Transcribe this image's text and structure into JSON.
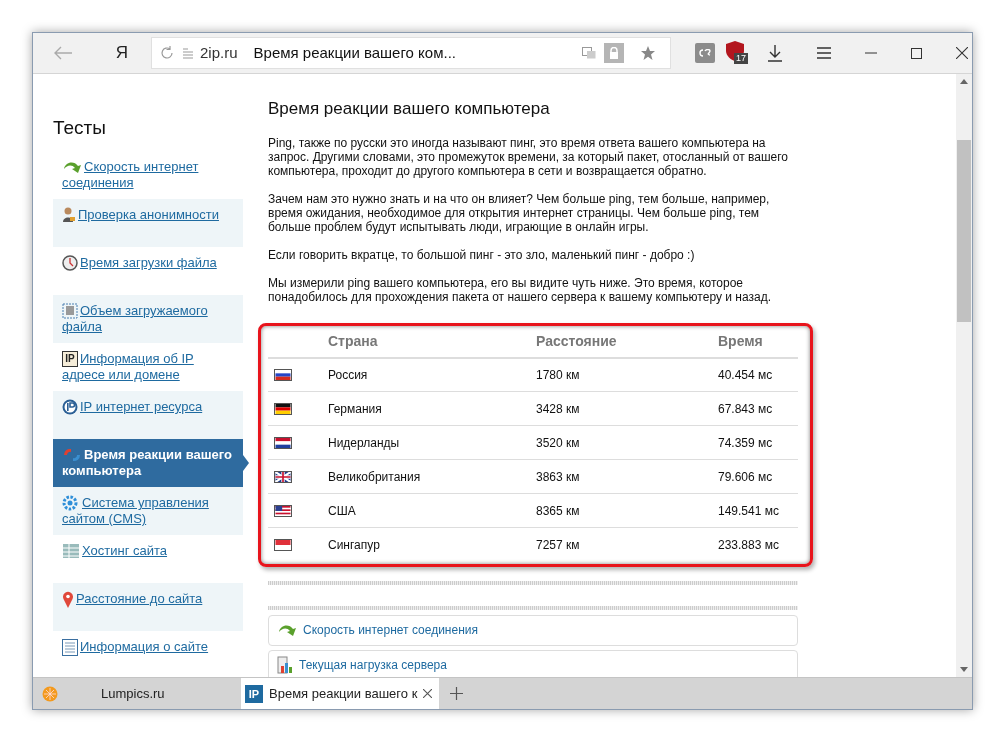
{
  "toolbar": {
    "logo": "Я",
    "domain": "2ip.ru",
    "page_title": "Время реакции вашего ком...",
    "extension_badge": "17"
  },
  "sidebar": {
    "title": "Тесты",
    "items": [
      {
        "label": "Скорость интернет соединения",
        "selected": false
      },
      {
        "label": "Проверка анонимности",
        "selected": false
      },
      {
        "label": "Время загрузки файла",
        "selected": false
      },
      {
        "label": "Объем загружаемого файла",
        "selected": false
      },
      {
        "label": "Информация об IP адресе или домене",
        "selected": false,
        "icon_label": "IP"
      },
      {
        "label": "IP интернет ресурса",
        "selected": false
      },
      {
        "label": "Время реакции вашего компьютера",
        "selected": true
      },
      {
        "label": "Система управления сайтом (CMS)",
        "selected": false
      },
      {
        "label": "Хостинг сайта",
        "selected": false
      },
      {
        "label": "Расстояние до сайта",
        "selected": false
      },
      {
        "label": "Информация о сайте",
        "selected": false
      }
    ]
  },
  "article": {
    "title": "Время реакции вашего компьютера",
    "paragraphs": [
      "Ping, также по русски это иногда называют пинг, это время ответа вашего компьютера на запрос. Другими словами, это промежуток времени, за который пакет, отосланный от вашего компьютера, проходит до другого компьютера в сети и возвращается обратно.",
      "Зачем нам это нужно знать и на что он влияет? Чем больше ping, тем больше, например, время ожидания, необходимое для открытия интернет страницы. Чем больше ping, тем больше проблем будут испытывать люди, играющие в онлайн игры.",
      "Если говорить вкратце, то большой пинг - это зло, маленький пинг - добро :)",
      "Мы измерили ping вашего компьютера, его вы видите чуть ниже. Это время, которое понадобилось для прохождения пакета от нашего сервера к вашему компьютеру и назад."
    ]
  },
  "ping_table": {
    "columns": [
      "Страна",
      "Расстояние",
      "Время"
    ],
    "rows": [
      {
        "kind": "ru",
        "country": "Россия",
        "distance": "1780 км",
        "time": "40.454 мс"
      },
      {
        "kind": "de",
        "country": "Германия",
        "distance": "3428 км",
        "time": "67.843 мс"
      },
      {
        "kind": "nl",
        "country": "Нидерланды",
        "distance": "3520 км",
        "time": "74.359 мс"
      },
      {
        "kind": "gb",
        "country": "Великобритания",
        "distance": "3863 км",
        "time": "79.606 мс"
      },
      {
        "kind": "us",
        "country": "США",
        "distance": "8365 км",
        "time": "149.541 мс"
      },
      {
        "kind": "sg",
        "country": "Сингапур",
        "distance": "7257 км",
        "time": "233.883 мс"
      }
    ]
  },
  "related_links": [
    "Скорость интернет соединения",
    "Текущая нагрузка сервера"
  ],
  "tabs": [
    {
      "label": "Lumpics.ru",
      "selected": false
    },
    {
      "label": "Время реакции вашего к",
      "selected": true,
      "icon_label": "IP"
    }
  ]
}
